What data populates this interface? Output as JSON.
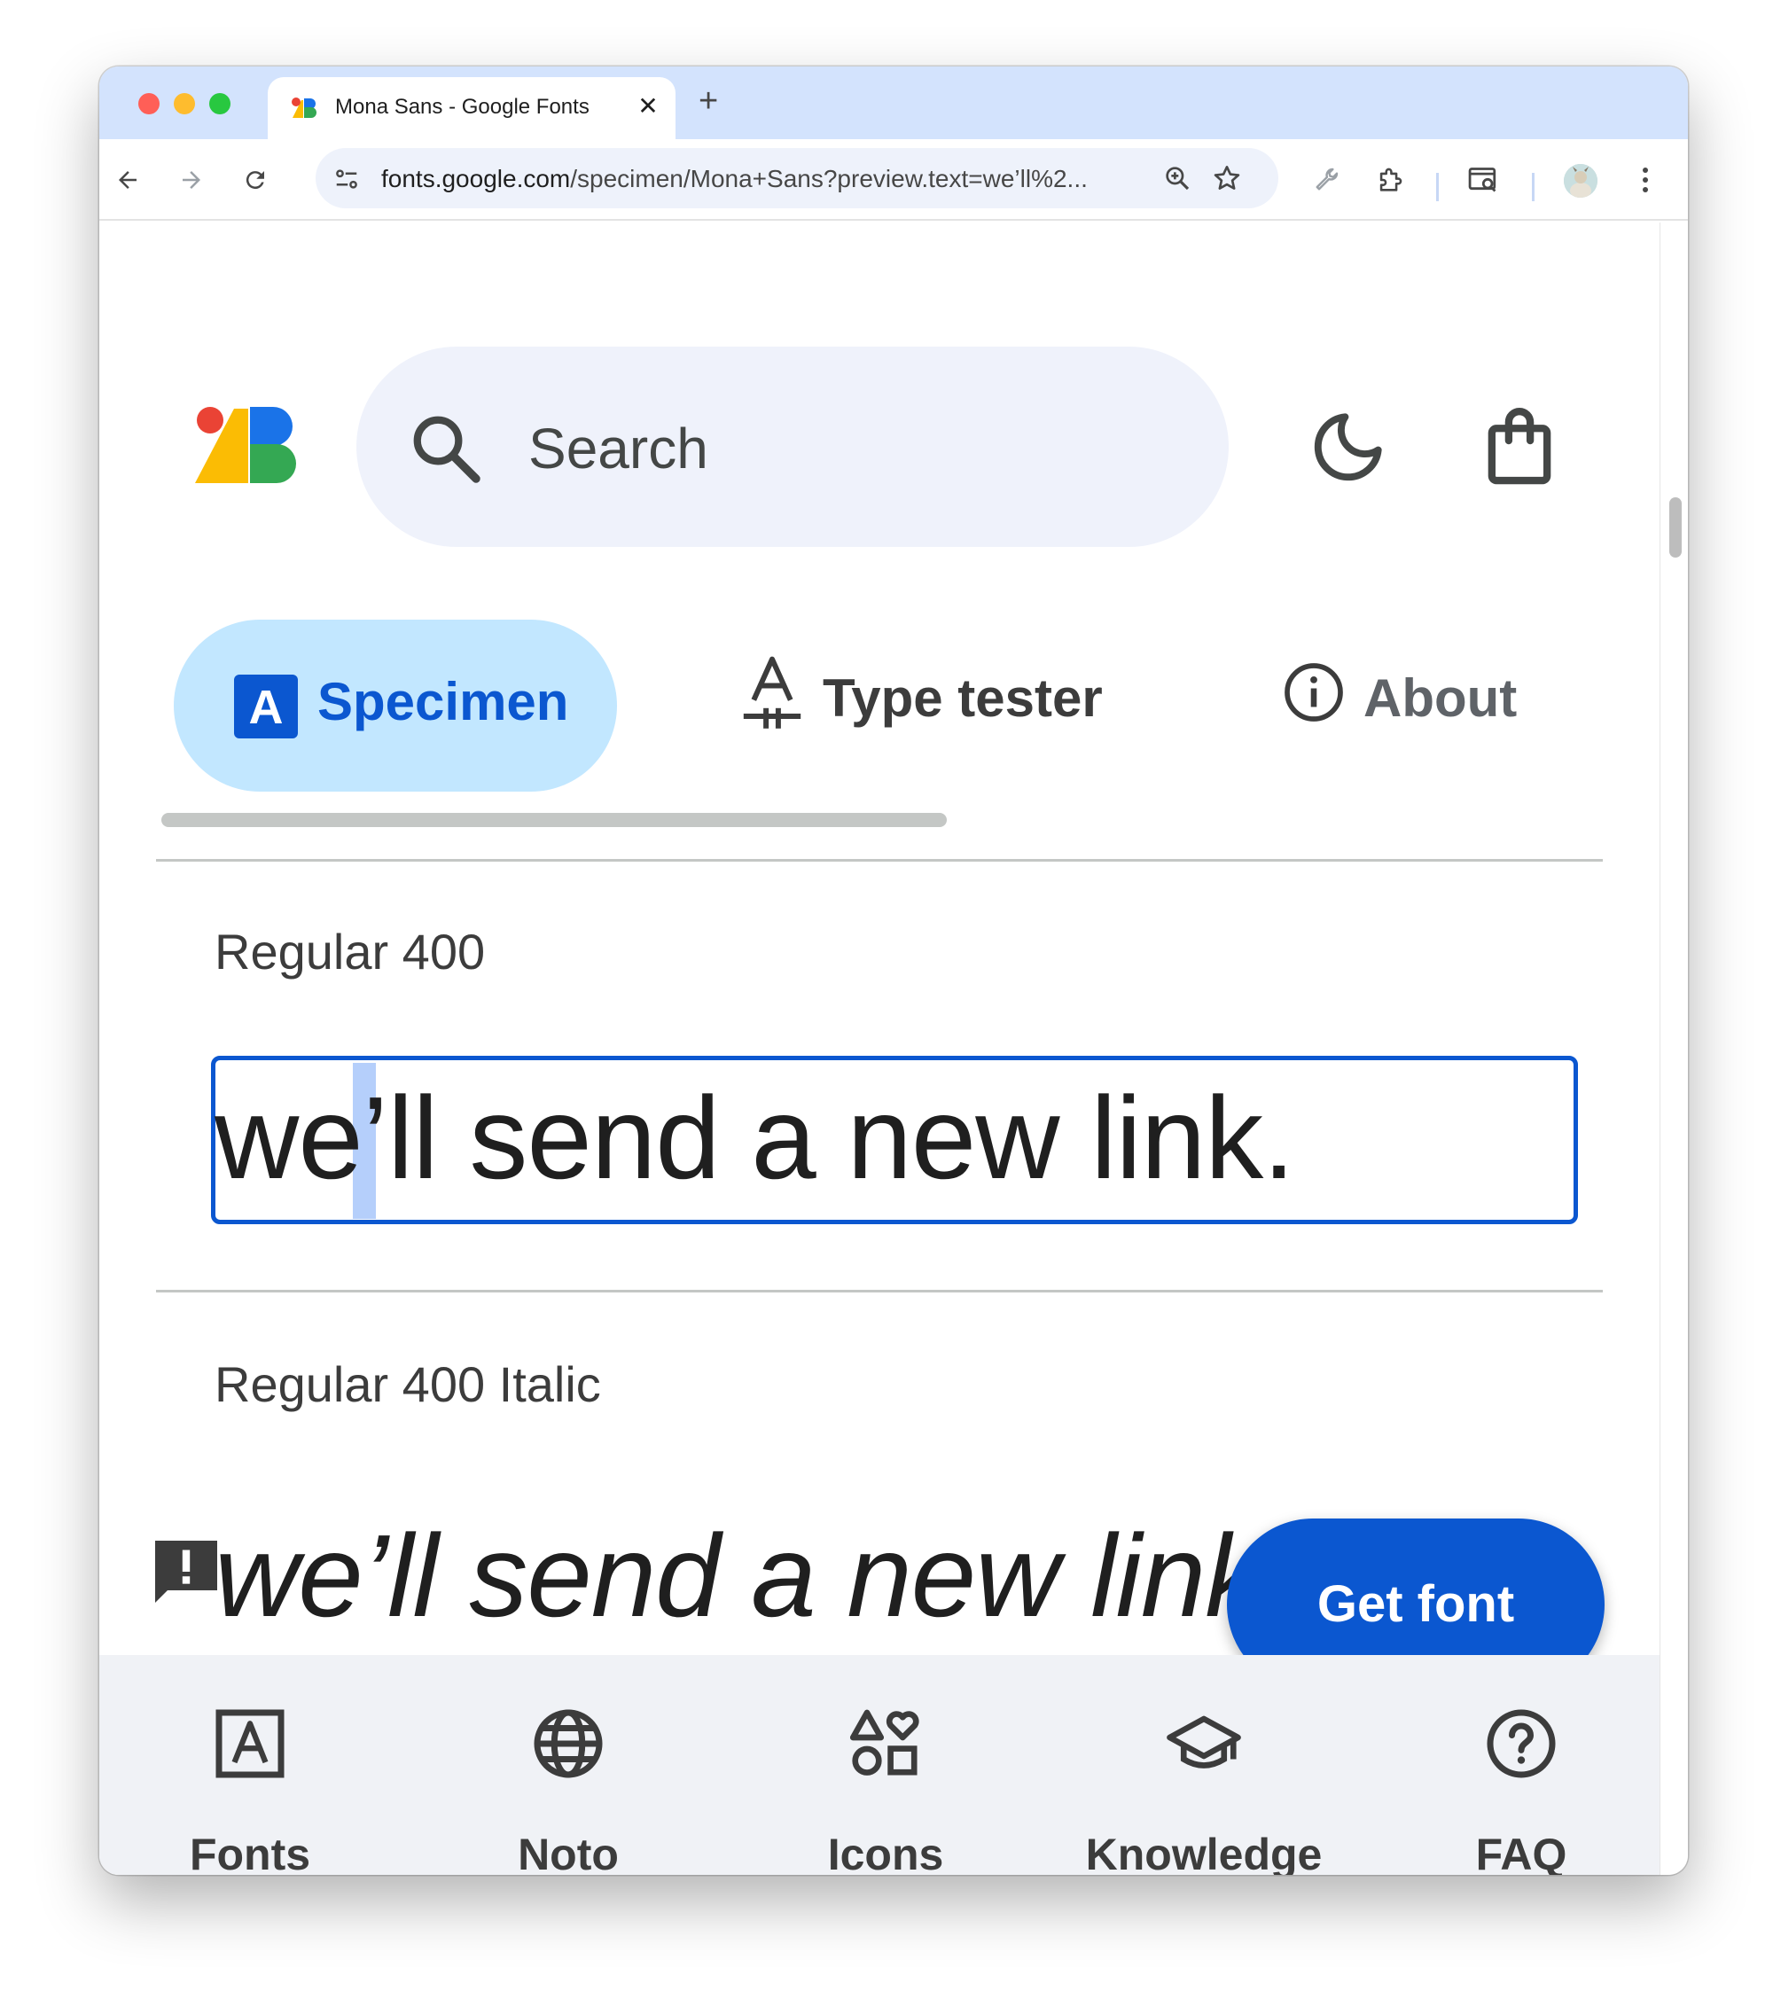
{
  "browser": {
    "tab_title": "Mona Sans - Google Fonts",
    "tab_close": "✕",
    "new_tab": "+",
    "url_host": "fonts.google.com",
    "url_path": "/specimen/Mona+Sans?preview.text=we’ll%2..."
  },
  "header": {
    "search_placeholder": "Search"
  },
  "tabs": [
    {
      "label": "Specimen",
      "icon": "A",
      "selected": true
    },
    {
      "label": "Type tester",
      "icon": "type-tester-icon"
    },
    {
      "label": "About",
      "icon": "info-icon"
    }
  ],
  "styles": [
    {
      "name": "Regular 400",
      "preview": "we’ll send a new link."
    },
    {
      "name": "Regular 400 Italic",
      "preview": "we’ll send a new link."
    }
  ],
  "cta": {
    "label": "Get font"
  },
  "bottom_nav": [
    {
      "label": "Fonts",
      "icon": "fonts-icon"
    },
    {
      "label": "Noto",
      "icon": "globe-icon"
    },
    {
      "label": "Icons",
      "icon": "shapes-icon"
    },
    {
      "label": "Knowledge",
      "icon": "graduation-cap-icon"
    },
    {
      "label": "FAQ",
      "icon": "help-icon"
    }
  ],
  "colors": {
    "accent": "#0b57d0",
    "selected_tab_bg": "#c2e7ff",
    "search_bg": "#eff2fb",
    "bottom_nav_bg": "#f0f2f6"
  }
}
